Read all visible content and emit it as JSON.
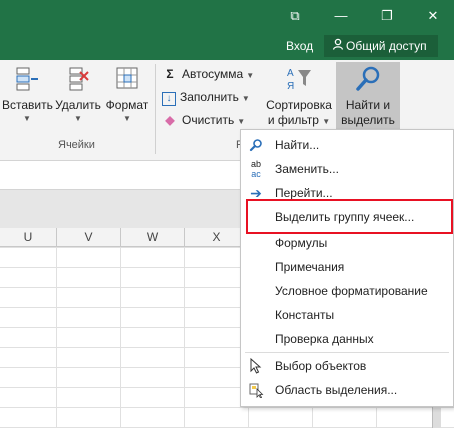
{
  "window": {
    "restore_glyph": "⧉",
    "minimize_glyph": "—",
    "maximize_glyph": "❐",
    "close_glyph": "✕",
    "login_label": "Вход",
    "share_label": "Общий доступ"
  },
  "ribbon": {
    "cells_group": {
      "label": "Ячейки",
      "insert_label": "Вставить",
      "delete_label": "Удалить",
      "format_label": "Формат"
    },
    "editing_group": {
      "label": "Р",
      "autosum_label": "Автосумма",
      "fill_label": "Заполнить",
      "clear_label": "Очистить",
      "sort_label_line1": "Сортировка",
      "sort_label_line2": "и фильтр",
      "find_label_line1": "Найти и",
      "find_label_line2": "выделить"
    }
  },
  "grid": {
    "columns": [
      "U",
      "V",
      "W",
      "X"
    ]
  },
  "find_menu": {
    "items": [
      {
        "label": "Найти...",
        "icon": "magnifier-icon"
      },
      {
        "label": "Заменить...",
        "icon": "replace-icon"
      },
      {
        "label": "Перейти...",
        "icon": "arrow-right-icon"
      },
      {
        "label": "Выделить группу ячеек..."
      },
      {
        "label": "Формулы"
      },
      {
        "label": "Примечания"
      },
      {
        "label": "Условное форматирование"
      },
      {
        "label": "Константы"
      },
      {
        "label": "Проверка данных"
      },
      {
        "label": "Выбор объектов",
        "icon": "pointer-icon"
      },
      {
        "label": "Область выделения...",
        "icon": "selection-pane-icon"
      }
    ],
    "highlighted_item": "Выделить группу ячеек...",
    "highlight_color": "#e81123"
  },
  "colors": {
    "titlebar": "#217346",
    "ribbon_bg": "#f3f3f3",
    "pressed_button": "#c5c5c5"
  }
}
